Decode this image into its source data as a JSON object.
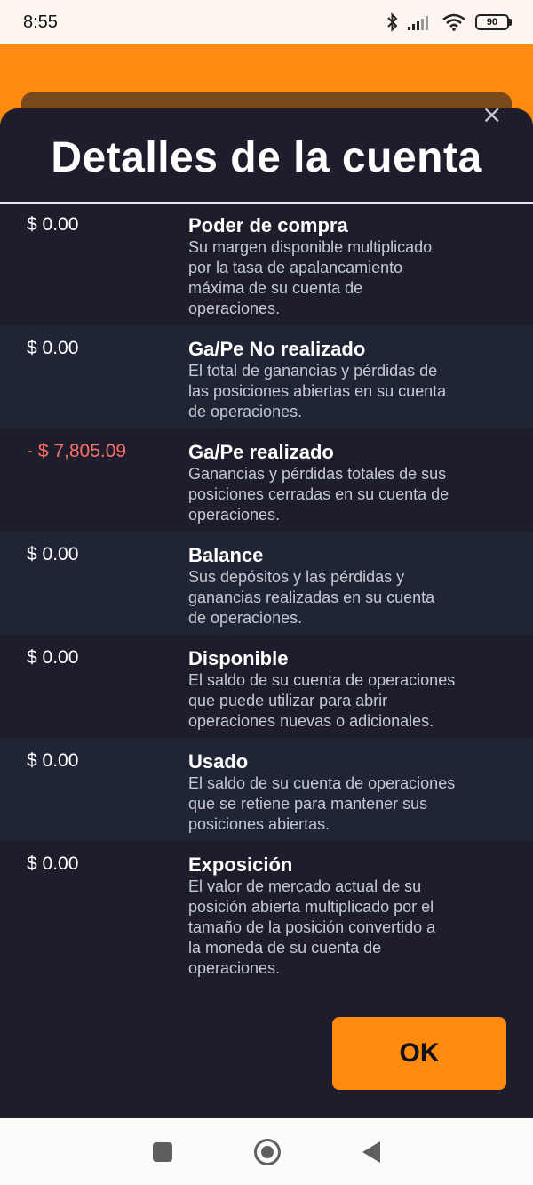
{
  "status_bar": {
    "time": "8:55",
    "battery": "90",
    "icons": [
      "bluetooth-icon",
      "signal-icon",
      "wifi-icon",
      "battery-icon"
    ]
  },
  "sheet": {
    "title": "Detalles de la cuenta",
    "close_icon": "×",
    "ok_label": "OK"
  },
  "rows": [
    {
      "value": "$ 0.00",
      "title": "Poder de compra",
      "desc_lines": [
        "Su margen disponible multiplicado",
        "por la tasa de apalancamiento",
        "máxima de su cuenta de",
        "operaciones."
      ]
    },
    {
      "value": "$ 0.00",
      "title": "Ga/Pe No realizado",
      "desc_lines": [
        "El total de ganancias y pérdidas de",
        "las posiciones abiertas en su cuenta",
        "de operaciones."
      ]
    },
    {
      "value": "- $ 7,805.09",
      "title": "Ga/Pe realizado",
      "desc_lines": [
        "Ganancias y pérdidas totales de sus",
        "posiciones cerradas en su cuenta de",
        "operaciones."
      ]
    },
    {
      "value": "$ 0.00",
      "title": "Balance",
      "desc_lines": [
        "Sus depósitos y las pérdidas y",
        "ganancias realizadas en su cuenta",
        "de operaciones."
      ]
    },
    {
      "value": "$ 0.00",
      "title": "Disponible",
      "desc_lines": [
        "El saldo de su cuenta de operaciones",
        "que puede utilizar para abrir",
        "operaciones nuevas o adicionales."
      ]
    },
    {
      "value": "$ 0.00",
      "title": "Usado",
      "desc_lines": [
        "El saldo de su cuenta de operaciones",
        "que se retiene para mantener sus",
        "posiciones abiertas."
      ]
    },
    {
      "value": "$ 0.00",
      "title": "Exposición",
      "desc_lines": [
        "El valor de mercado actual de su",
        "posición abierta multiplicado por el",
        "tamaño de la posición convertido a",
        "la moneda de su cuenta de",
        "operaciones."
      ]
    }
  ],
  "colors": {
    "accent": "#ff8a10",
    "sheet_bg": "#1d1d2c",
    "row_alt_bg": "#1f2535",
    "negative": "#ff6e66"
  }
}
